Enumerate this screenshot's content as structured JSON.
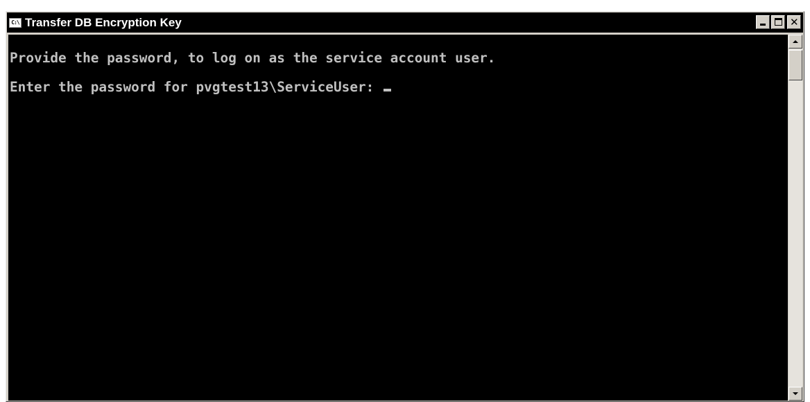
{
  "window": {
    "title": "Transfer DB Encryption Key",
    "icon": "console-icon",
    "icon_text": "C:\\"
  },
  "caption_buttons": [
    {
      "name": "minimize",
      "icon": "minimize-icon"
    },
    {
      "name": "maximize",
      "icon": "maximize-icon"
    },
    {
      "name": "close",
      "icon": "close-icon",
      "glyph": "✕"
    }
  ],
  "console": {
    "lines": [
      "Provide the password, to log on as the service account user.",
      "Enter the password for pvgtest13\\ServiceUser: "
    ],
    "text_color": "#c0c0c0",
    "background_color": "#000000"
  },
  "scrollbar": {
    "up_icon": "arrow-up-icon",
    "down_icon": "arrow-down-icon"
  }
}
